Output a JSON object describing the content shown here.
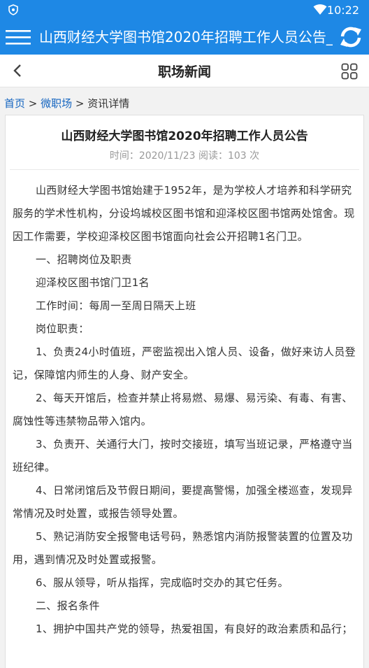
{
  "status": {
    "time": "10:22",
    "shield_icon": "shield-icon",
    "wifi_icon": "wifi-icon"
  },
  "appbar": {
    "title": "山西财经大学图书馆2020年招聘工作人员公告_...",
    "menu_icon": "menu-icon",
    "refresh_icon": "refresh-icon",
    "color": "#1e88e5"
  },
  "nav": {
    "title": "职场新闻",
    "back_icon": "back-icon",
    "grid_icon": "grid-icon"
  },
  "breadcrumb": {
    "home": "首页",
    "sep1": " > ",
    "section": "微职场",
    "sep2": " > ",
    "current": "资讯详情"
  },
  "article": {
    "title": "山西财经大学图书馆2020年招聘工作人员公告",
    "meta": "时间：2020/11/23 阅读：103 次",
    "paragraphs": [
      "山西财经大学图书馆始建于1952年，是为学校人才培养和科学研究服务的学术性机构，分设坞城校区图书馆和迎泽校区图书馆两处馆舍。现因工作需要，学校迎泽校区图书馆面向社会公开招聘1名门卫。",
      "一、招聘岗位及职责",
      "迎泽校区图书馆门卫1名",
      "工作时间：每周一至周日隔天上班",
      "岗位职责：",
      "1、负责24小时值班，严密监视出入馆人员、设备，做好来访人员登记，保障馆内师生的人身、财产安全。",
      "2、每天开馆后，检查并禁止将易燃、易爆、易污染、有毒、有害、腐蚀性等违禁物品带入馆内。",
      "3、负责开、关通行大门，按时交接班，填写当班记录，严格遵守当班纪律。",
      "4、日常闭馆后及节假日期间，要提高警惕，加强全楼巡查，发现异常情况及时处置，或报告领导处置。",
      "5、熟记消防安全报警电话号码，熟悉馆内消防报警装置的位置及功用，遇到情况及时处置或报警。",
      "6、服从领导，听从指挥，完成临时交办的其它任务。",
      "二、报名条件",
      "1、拥护中国共产党的领导，热爱祖国，有良好的政治素质和品行；"
    ]
  }
}
